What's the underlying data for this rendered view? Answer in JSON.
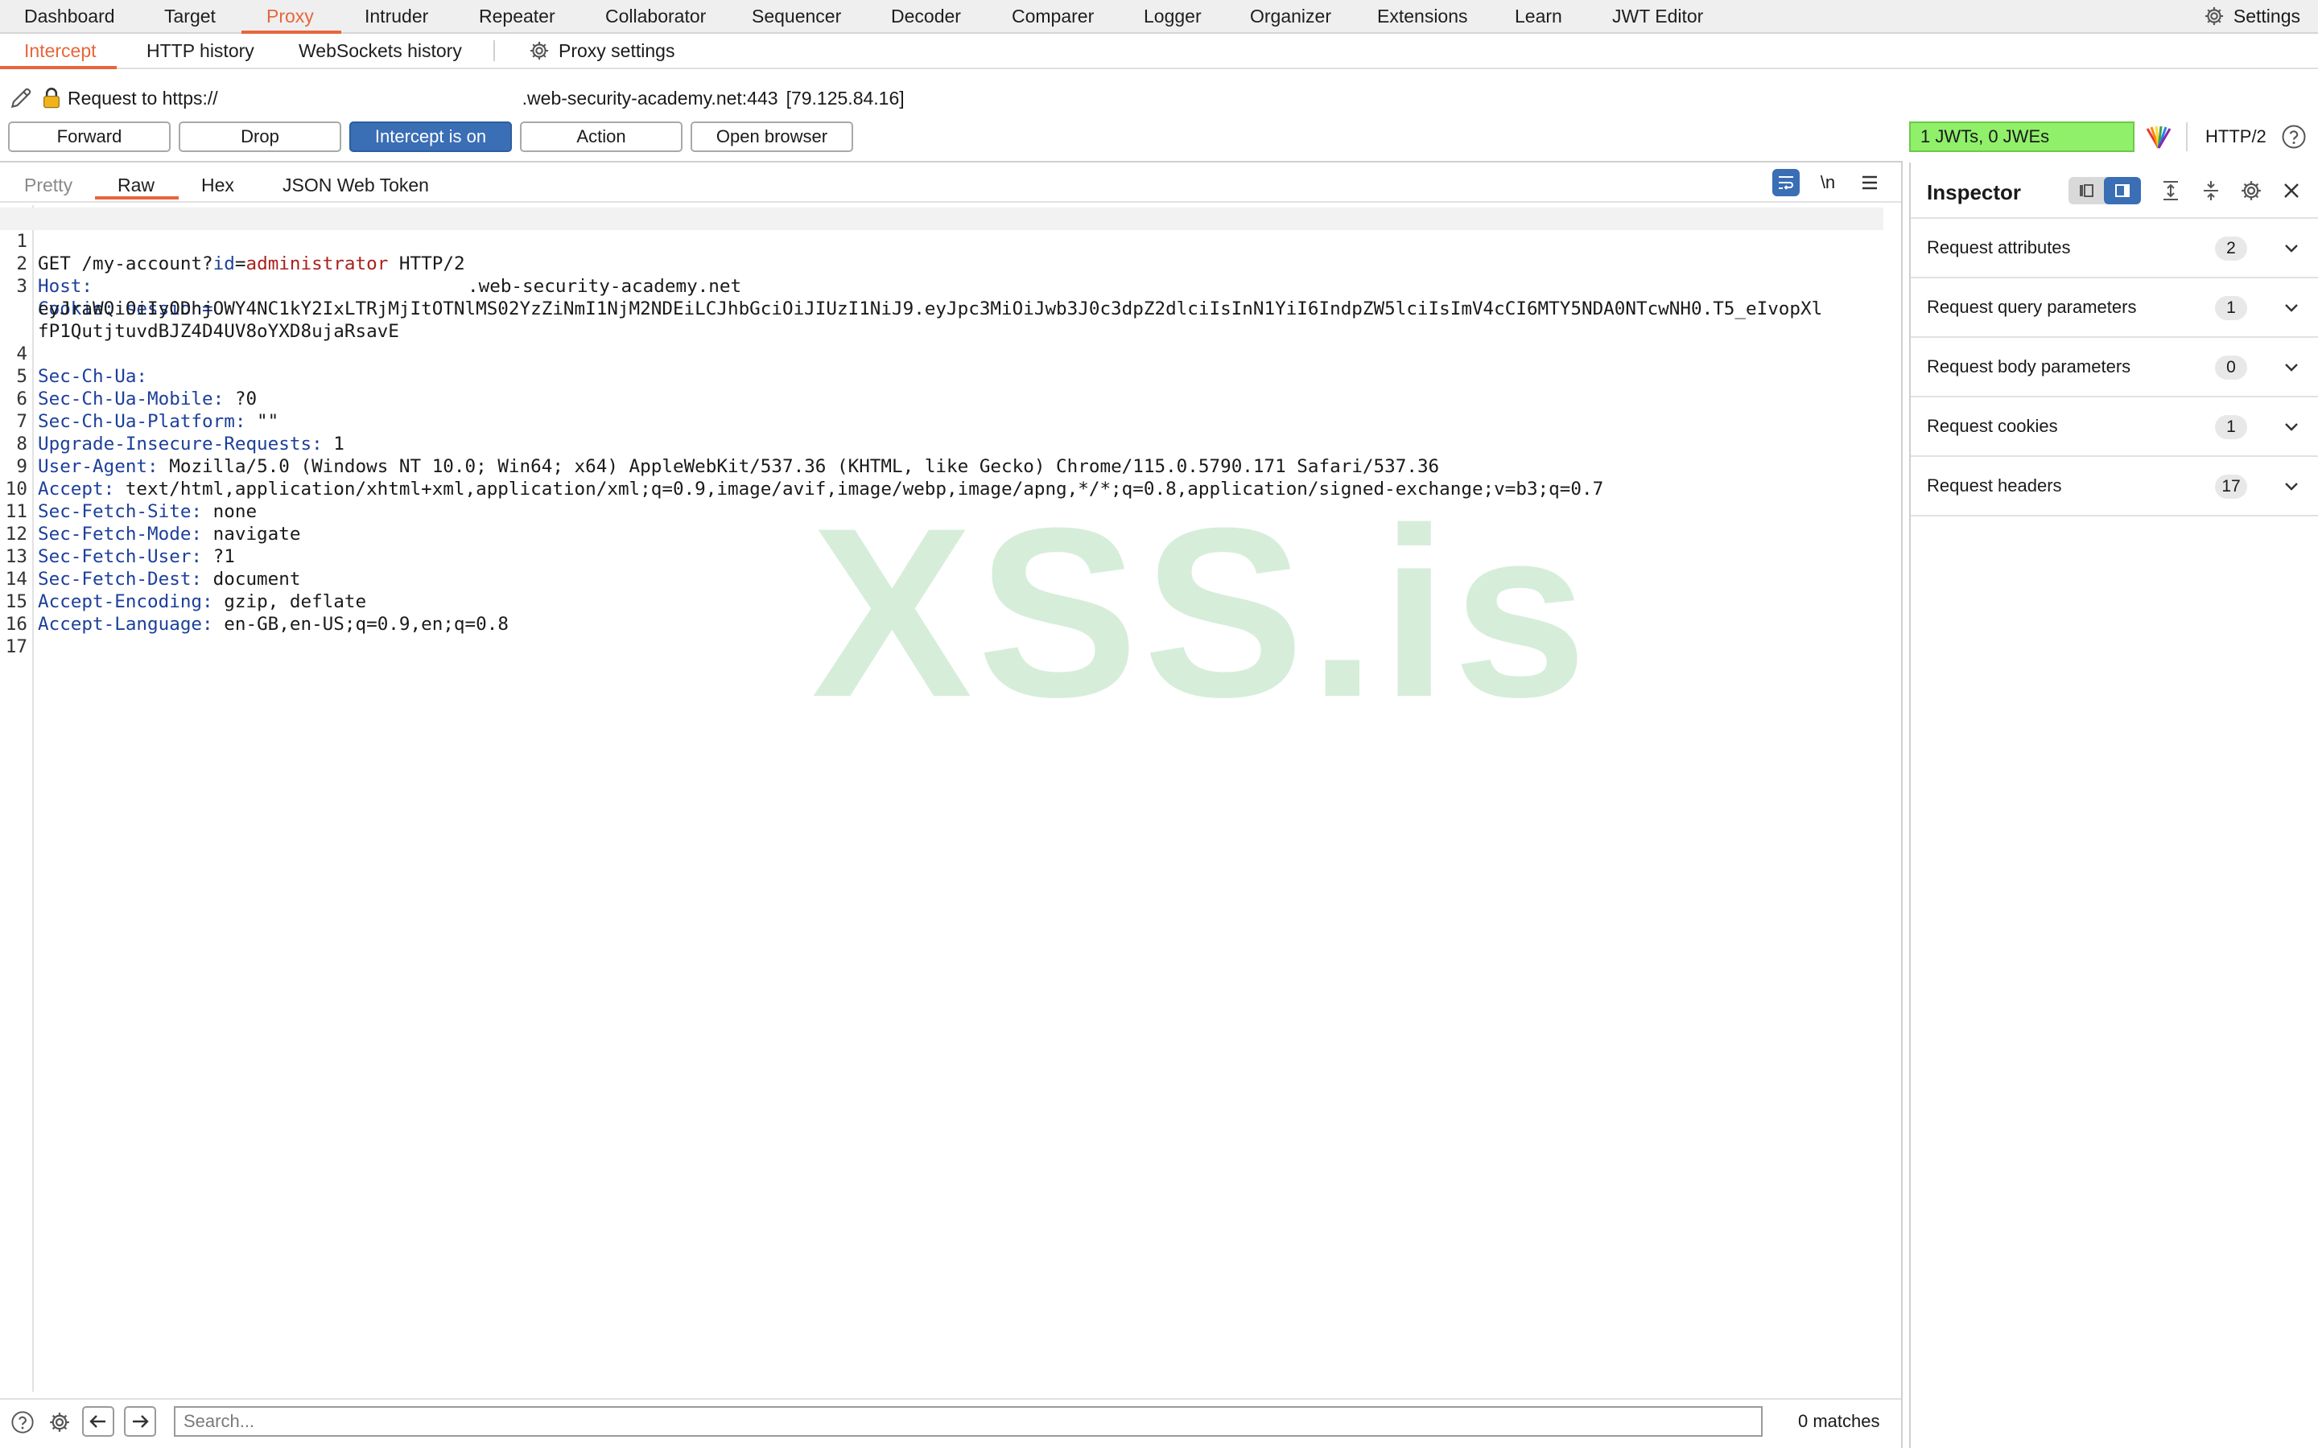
{
  "menu": {
    "tabs": [
      "Dashboard",
      "Target",
      "Proxy",
      "Intruder",
      "Repeater",
      "Collaborator",
      "Sequencer",
      "Decoder",
      "Comparer",
      "Logger",
      "Organizer",
      "Extensions",
      "Learn",
      "JWT Editor"
    ],
    "active": "Proxy",
    "settings_label": "Settings"
  },
  "proxy_tabs": {
    "tabs": [
      "Intercept",
      "HTTP history",
      "WebSockets history"
    ],
    "active": "Intercept",
    "settings_label": "Proxy settings"
  },
  "request_info": {
    "prefix": "Request to https://",
    "host_suffix": ".web-security-academy.net:443",
    "ip": "[79.125.84.16]"
  },
  "actions": {
    "forward": "Forward",
    "drop": "Drop",
    "intercept": "Intercept is on",
    "action": "Action",
    "open_browser": "Open browser"
  },
  "jwt_badge": "1 JWTs, 0 JWEs",
  "protocol": "HTTP/2",
  "editor_tabs": {
    "pretty": "Pretty",
    "raw": "Raw",
    "hex": "Hex",
    "jwt": "JSON Web Token",
    "active": "Raw",
    "newline_toggle": "\\n"
  },
  "request_lines": {
    "l1_method": "GET ",
    "l1_path": "/my-account?",
    "l1_param": "id",
    "l1_eq": "=",
    "l1_value": "administrator",
    "l1_proto": " HTTP/2",
    "l2_key": "Host:",
    "l2_value": ".web-security-academy.net",
    "l3_key": "Cookie:",
    "l3_name": " session=",
    "l3_cookie_1": "eyJraWQiOiIyODhjOWY4NC1kY2IxLTRjMjItOTNlMS02YzZiNmI1NjM2NDEiLCJhbGciOiJIUzI1NiJ9.eyJpc3MiOiJwb3J0c3dpZ2dlciIsInN1YiI6IndpZW5lciIsImV4cCI6MTY5NDA0NTcwNH0.T5_eIvopXl",
    "l3_cookie_2": "fP1QutjtuvdBJZ4D4UV8oYXD8ujaRsavE",
    "l4_key": "Sec-Ch-Ua:",
    "l4_value": "",
    "l5_key": "Sec-Ch-Ua-Mobile:",
    "l5_value": " ?0",
    "l6_key": "Sec-Ch-Ua-Platform:",
    "l6_value": " \"\"",
    "l7_key": "Upgrade-Insecure-Requests:",
    "l7_value": " 1",
    "l8_key": "User-Agent:",
    "l8_value": " Mozilla/5.0 (Windows NT 10.0; Win64; x64) AppleWebKit/537.36 (KHTML, like Gecko) Chrome/115.0.5790.171 Safari/537.36",
    "l9_key": "Accept:",
    "l9_value": " text/html,application/xhtml+xml,application/xml;q=0.9,image/avif,image/webp,image/apng,*/*;q=0.8,application/signed-exchange;v=b3;q=0.7",
    "l10_key": "Sec-Fetch-Site:",
    "l10_value": " none",
    "l11_key": "Sec-Fetch-Mode:",
    "l11_value": " navigate",
    "l12_key": "Sec-Fetch-User:",
    "l12_value": " ?1",
    "l13_key": "Sec-Fetch-Dest:",
    "l13_value": " document",
    "l14_key": "Accept-Encoding:",
    "l14_value": " gzip, deflate",
    "l15_key": "Accept-Language:",
    "l15_value": " en-GB,en-US;q=0.9,en;q=0.8"
  },
  "line_numbers": [
    "1",
    "2",
    "3",
    "4",
    "5",
    "6",
    "7",
    "8",
    "9",
    "10",
    "11",
    "12",
    "13",
    "14",
    "15",
    "16",
    "17"
  ],
  "watermark": "XSS.is",
  "search": {
    "placeholder": "Search...",
    "matches": "0 matches"
  },
  "inspector": {
    "title": "Inspector",
    "sections": [
      {
        "label": "Request attributes",
        "count": "2"
      },
      {
        "label": "Request query parameters",
        "count": "1"
      },
      {
        "label": "Request body parameters",
        "count": "0"
      },
      {
        "label": "Request cookies",
        "count": "1"
      },
      {
        "label": "Request headers",
        "count": "17"
      }
    ]
  },
  "colors": {
    "accent": "#e8663b",
    "primary_button": "#3a6eb5",
    "jwt_badge": "#90f06a",
    "header_key": "#1c3f9b",
    "value_red": "#a8221c"
  }
}
